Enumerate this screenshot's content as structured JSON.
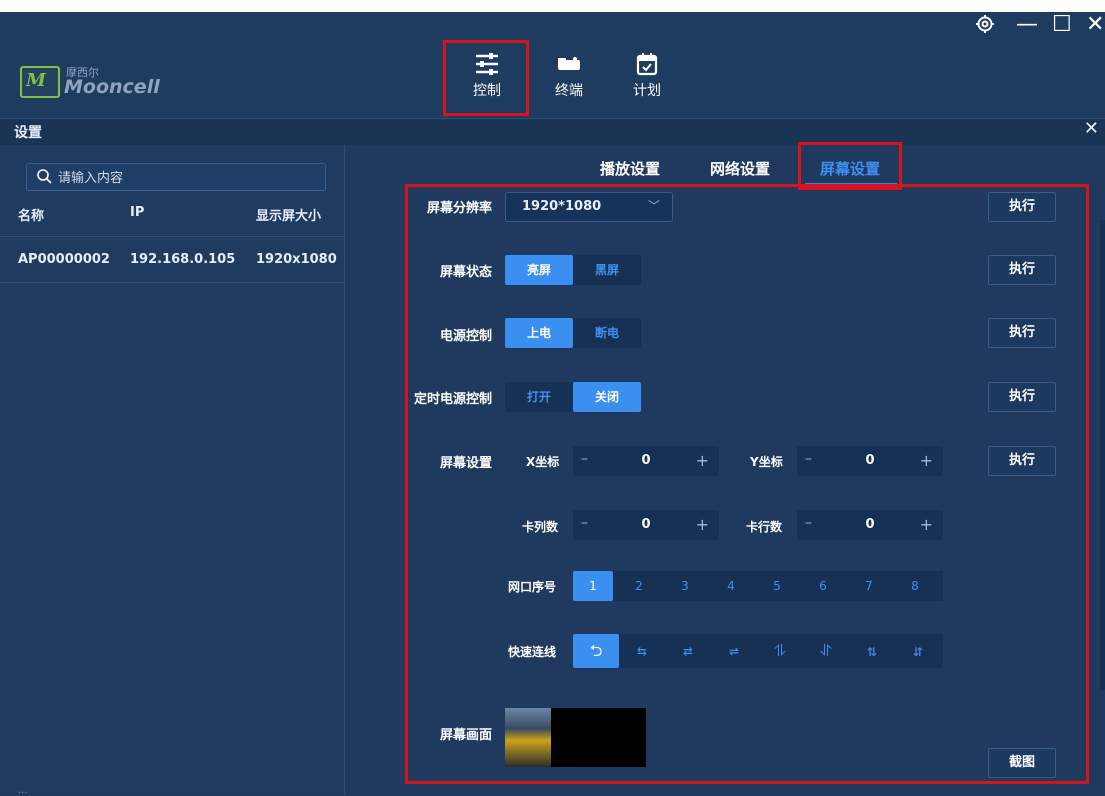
{
  "app": {
    "logo_small": "摩西尔",
    "logo_big": "Mooncell",
    "logo_mark": "M"
  },
  "nav": {
    "items": [
      {
        "label": "控制",
        "icon": "sliders-icon",
        "active": true
      },
      {
        "label": "终端",
        "icon": "terminal-device-icon"
      },
      {
        "label": "计划",
        "icon": "calendar-icon"
      }
    ]
  },
  "window": {
    "settings_icon": "gear-icon",
    "minimize": "—",
    "maximize": "☐",
    "close": "✕"
  },
  "settings": {
    "title": "设置",
    "close": "✕"
  },
  "left": {
    "search_placeholder": "请输入内容",
    "columns": [
      "名称",
      "IP",
      "显示屏大小"
    ],
    "rows": [
      {
        "name": "AP00000002",
        "ip": "192.168.0.105",
        "size": "1920x1080"
      }
    ]
  },
  "tabs": [
    "播放设置",
    "网络设置",
    "屏幕设置"
  ],
  "screen": {
    "resolution_label": "屏幕分辨率",
    "resolution_value": "1920*1080",
    "state_label": "屏幕状态",
    "state_options": [
      "亮屏",
      "黑屏"
    ],
    "power_label": "电源控制",
    "power_options": [
      "上电",
      "断电"
    ],
    "timer_label": "定时电源控制",
    "timer_options": [
      "打开",
      "关闭"
    ],
    "screen_setting_label": "屏幕设置",
    "x_label": "X坐标",
    "x_value": "0",
    "y_label": "Y坐标",
    "y_value": "0",
    "cols_label": "卡列数",
    "cols_value": "0",
    "rows_label": "卡行数",
    "rows_value": "0",
    "port_label": "网口序号",
    "ports": [
      "1",
      "2",
      "3",
      "4",
      "5",
      "6",
      "7",
      "8"
    ],
    "wiring_label": "快速连线",
    "wiring_glyphs": [
      "⮌",
      "⇆",
      "⇄",
      "⇌",
      "⥮",
      "⥯",
      "⇅",
      "⇵"
    ],
    "picture_label": "屏幕画面",
    "minus": "–",
    "plus": "+",
    "exec": "执行",
    "screenshot": "截图"
  },
  "status": {
    "bottom_text": "..."
  },
  "colors": {
    "accent": "#3b8ff0",
    "highlight_box": "#d5141b",
    "bg": "#1f3a5e"
  }
}
